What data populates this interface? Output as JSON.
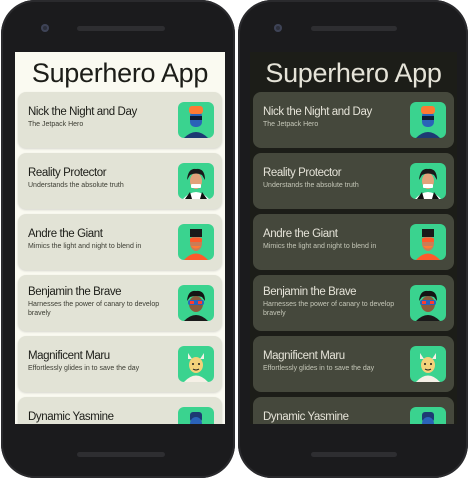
{
  "app_title": "Superhero App",
  "heroes": [
    {
      "name": "Nick the Night and Day",
      "power": "The Jetpack Hero",
      "avatar_icon": "hero-avatar-nick-icon"
    },
    {
      "name": "Reality Protector",
      "power": "Understands the absolute truth",
      "avatar_icon": "hero-avatar-reality-icon"
    },
    {
      "name": "Andre the Giant",
      "power": "Mimics the light and night to blend in",
      "avatar_icon": "hero-avatar-andre-icon"
    },
    {
      "name": "Benjamin the Brave",
      "power": "Harnesses the power of canary to develop bravely",
      "avatar_icon": "hero-avatar-benjamin-icon"
    },
    {
      "name": "Magnificent Maru",
      "power": "Effortlessly glides in to save the day",
      "avatar_icon": "hero-avatar-maru-icon"
    },
    {
      "name": "Dynamic Yasmine",
      "power": "",
      "avatar_icon": "hero-avatar-yasmine-icon"
    }
  ],
  "colors": {
    "light_background": "#fafaf1",
    "light_card": "#e2e3d6",
    "dark_background": "#1c1d18",
    "dark_card": "#45483c",
    "avatar_green": "#3ad38f"
  }
}
